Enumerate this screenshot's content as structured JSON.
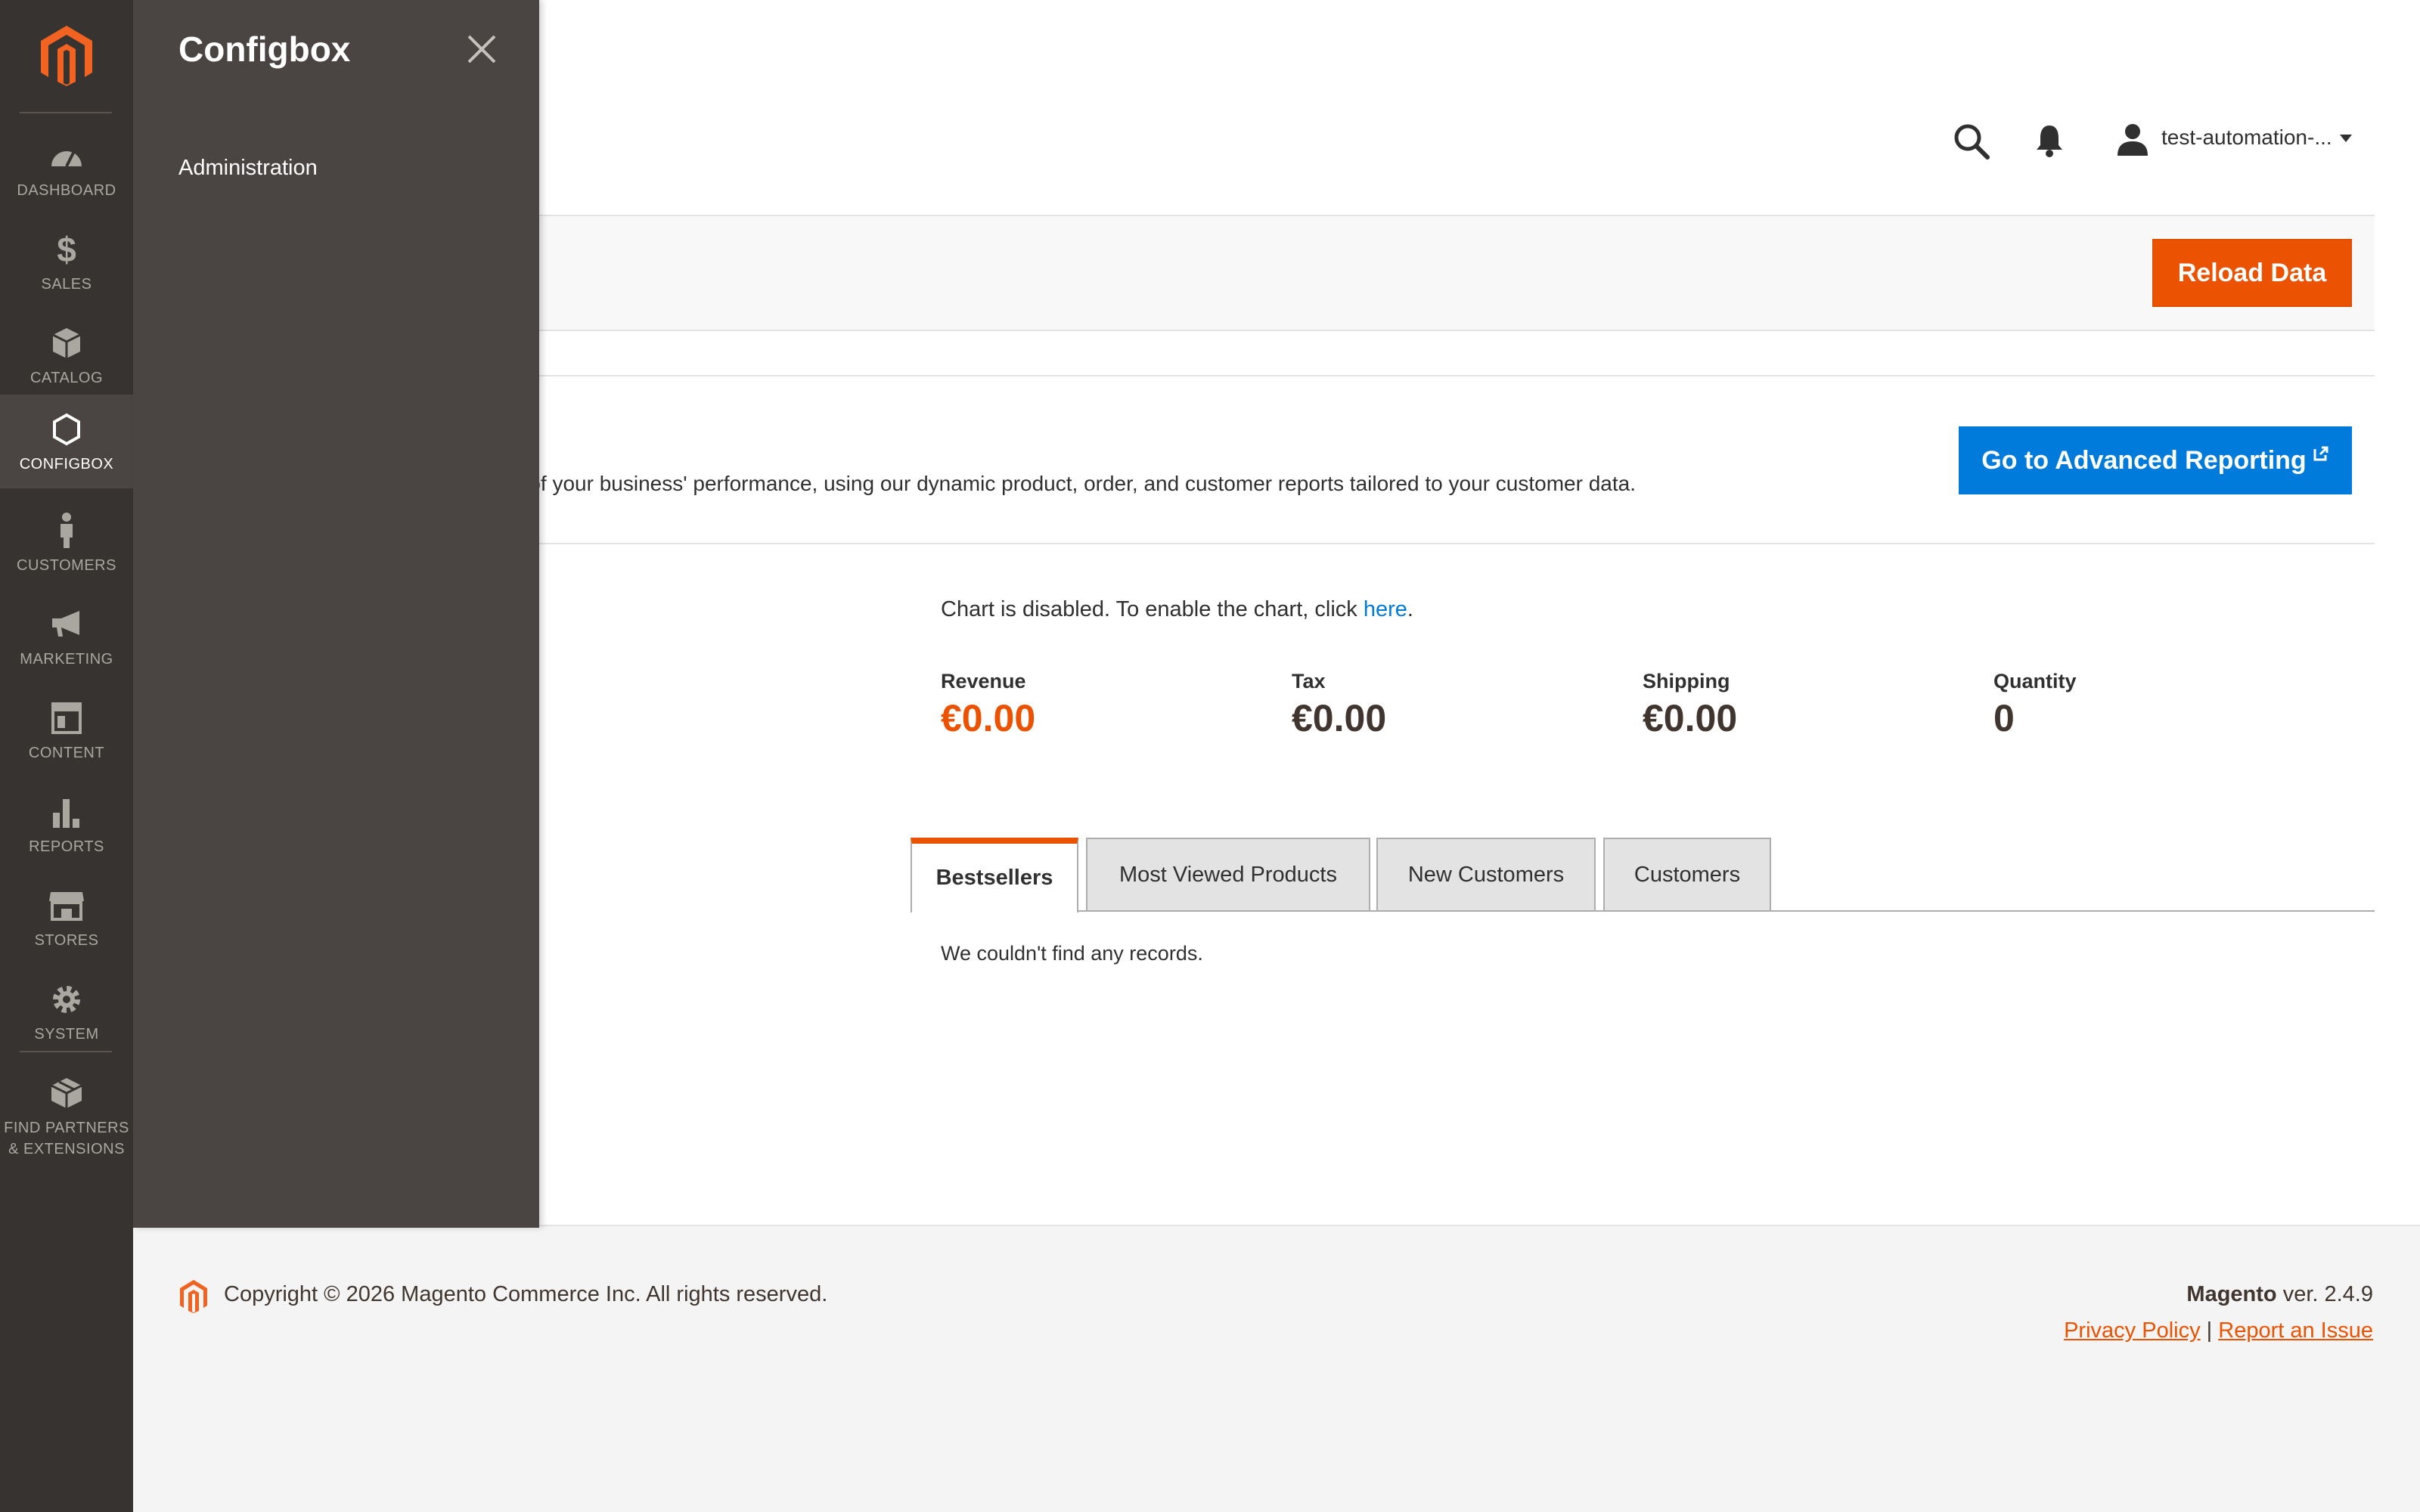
{
  "nav": {
    "items": [
      {
        "label": "DASHBOARD",
        "icon": "dashboard-icon"
      },
      {
        "label": "SALES",
        "icon": "dollar-icon"
      },
      {
        "label": "CATALOG",
        "icon": "box-icon"
      },
      {
        "label": "CONFIGBOX",
        "icon": "hexagon-icon",
        "active": true
      },
      {
        "label": "CUSTOMERS",
        "icon": "person-icon"
      },
      {
        "label": "MARKETING",
        "icon": "megaphone-icon"
      },
      {
        "label": "CONTENT",
        "icon": "layout-icon"
      },
      {
        "label": "REPORTS",
        "icon": "bar-chart-icon"
      },
      {
        "label": "STORES",
        "icon": "store-icon"
      },
      {
        "label": "SYSTEM",
        "icon": "gear-icon"
      }
    ],
    "extensions_line1": "FIND PARTNERS",
    "extensions_line2": "& EXTENSIONS"
  },
  "flyout": {
    "title": "Configbox",
    "link": "Administration"
  },
  "header": {
    "user_name": "test-automation-..."
  },
  "actions": {
    "reload": "Reload Data"
  },
  "advanced": {
    "text": "d of your business' performance, using our dynamic product, order, and customer reports tailored to your customer data.",
    "button": "Go to Advanced Reporting"
  },
  "chart": {
    "note_prefix": "Chart is disabled. To enable the chart, click ",
    "note_link": "here",
    "note_suffix": "."
  },
  "totals": [
    {
      "label": "Revenue",
      "value": "€0.00"
    },
    {
      "label": "Tax",
      "value": "€0.00"
    },
    {
      "label": "Shipping",
      "value": "€0.00"
    },
    {
      "label": "Quantity",
      "value": "0"
    }
  ],
  "tabs": [
    {
      "label": "Bestsellers"
    },
    {
      "label": "Most Viewed Products"
    },
    {
      "label": "New Customers"
    },
    {
      "label": "Customers"
    }
  ],
  "grid": {
    "empty": "We couldn't find any records."
  },
  "footer": {
    "copyright": "Copyright © 2026 Magento Commerce Inc. All rights reserved.",
    "brand": "Magento",
    "version": " ver. 2.4.9",
    "privacy": "Privacy Policy",
    "separator": "|",
    "report": "Report an Issue"
  },
  "colors": {
    "accent": "#eb5202",
    "primary_button": "#007bdb",
    "nav_bg": "#373330",
    "flyout_bg": "#4a4542"
  }
}
